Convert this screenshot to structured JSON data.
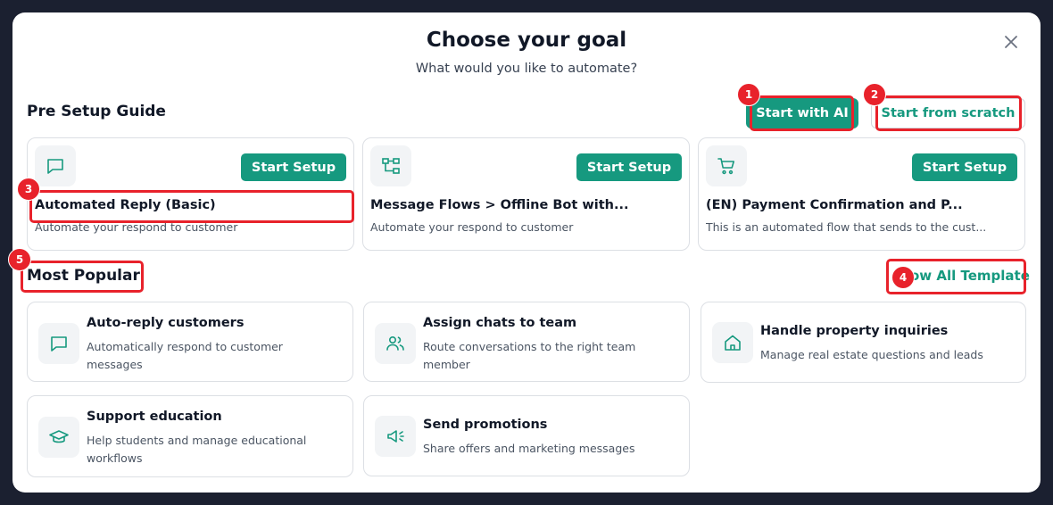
{
  "modal": {
    "title": "Choose your goal",
    "subtitle": "What would you like to automate?"
  },
  "pre_setup": {
    "heading": "Pre Setup Guide",
    "start_ai_label": "Start with AI",
    "start_scratch_label": "Start from scratch",
    "cards": [
      {
        "icon": "message-square-icon",
        "button": "Start Setup",
        "title": "Automated Reply (Basic)",
        "desc": "Automate your respond to customer"
      },
      {
        "icon": "workflow-icon",
        "button": "Start Setup",
        "title": "Message Flows > Offline Bot with...",
        "desc": "Automate your respond to customer"
      },
      {
        "icon": "shopping-cart-icon",
        "button": "Start Setup",
        "title": "(EN) Payment Confirmation and P...",
        "desc": "This is an automated flow that sends to the cust..."
      }
    ]
  },
  "popular": {
    "heading": "Most Popular",
    "show_all_label": "ow All Template",
    "cards": [
      {
        "icon": "message-square-icon",
        "title": "Auto-reply customers",
        "desc": "Automatically respond to customer messages"
      },
      {
        "icon": "users-icon",
        "title": "Assign chats to team",
        "desc": "Route conversations to the right team member"
      },
      {
        "icon": "home-icon",
        "title": "Handle property inquiries",
        "desc": "Manage real estate questions and leads"
      },
      {
        "icon": "graduation-cap-icon",
        "title": "Support education",
        "desc": "Help students and manage educational workflows"
      },
      {
        "icon": "megaphone-icon",
        "title": "Send promotions",
        "desc": "Share offers and marketing messages"
      }
    ]
  },
  "annotations": [
    "1",
    "2",
    "3",
    "4",
    "5"
  ],
  "colors": {
    "accent": "#16997f",
    "annotation": "#e8222b",
    "backdrop": "#1b2030"
  }
}
